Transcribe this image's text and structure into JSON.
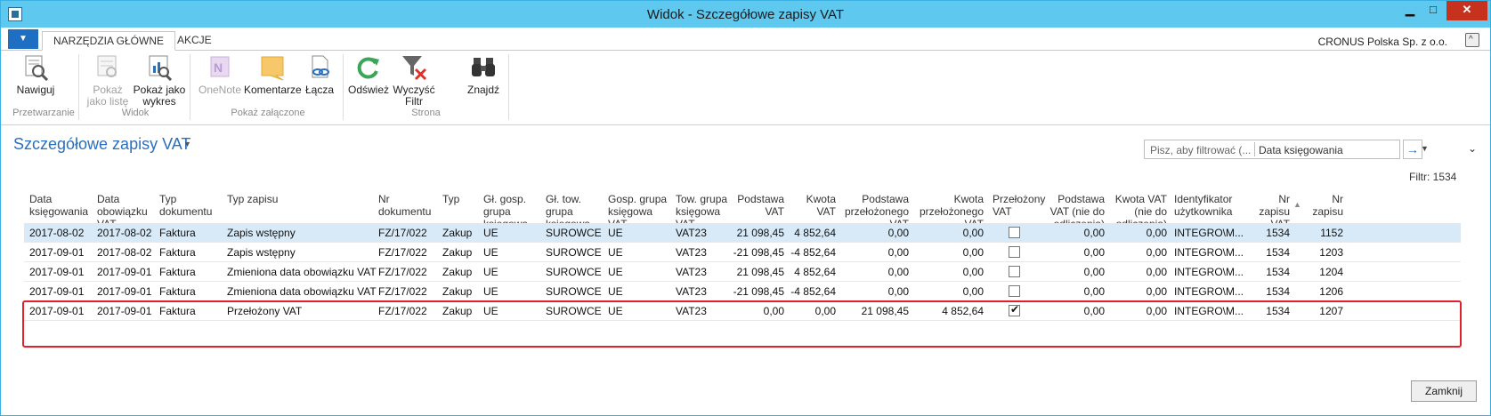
{
  "window": {
    "title": "Widok - Szczegółowe zapisy VAT"
  },
  "ribbon": {
    "tabs": [
      "NARZĘDZIA GŁÓWNE",
      "AKCJE"
    ],
    "company": "CRONUS Polska Sp. z o.o.",
    "buttons": {
      "nawiguj": "Nawiguj",
      "pokaz_liste_1": "Pokaż",
      "pokaz_liste_2": "jako listę",
      "pokaz_wykres_1": "Pokaż jako",
      "pokaz_wykres_2": "wykres",
      "onenote": "OneNote",
      "komentarze": "Komentarze",
      "lacza": "Łącza",
      "odswiez": "Odśwież",
      "wyczysc_1": "Wyczyść",
      "wyczysc_2": "Filtr",
      "znajdz": "Znajdź"
    },
    "groups": {
      "przetwarzanie": "Przetwarzanie",
      "widok": "Widok",
      "pokaz_zalaczone": "Pokaż załączone",
      "strona": "Strona"
    }
  },
  "page": {
    "title": "Szczegółowe zapisy VAT",
    "filter_placeholder": "Pisz, aby filtrować (...",
    "filter_field": "Data księgowania",
    "filter_count": "Filtr: 1534"
  },
  "table": {
    "headers": [
      [
        "Data",
        "księgowania"
      ],
      [
        "Data",
        "obowiązku",
        "VAT"
      ],
      [
        "Typ",
        "dokumentu"
      ],
      [
        "Typ zapisu"
      ],
      [
        "Nr",
        "dokumentu"
      ],
      [
        "Typ"
      ],
      [
        "Gł. gosp.",
        "grupa",
        "księgowa"
      ],
      [
        "Gł. tow.",
        "grupa",
        "księgowa"
      ],
      [
        "Gosp. grupa",
        "księgowa",
        "VAT"
      ],
      [
        "Tow. grupa",
        "księgowa",
        "VAT"
      ],
      [
        "Podstawa",
        "VAT"
      ],
      [
        "Kwota",
        "VAT"
      ],
      [
        "Podstawa",
        "przełożonego",
        "VAT"
      ],
      [
        "Kwota",
        "przełożonego",
        "VAT"
      ],
      [
        "Przełożony",
        "VAT"
      ],
      [
        "Podstawa",
        "VAT (nie do",
        "odliczenia)"
      ],
      [
        "Kwota VAT",
        "(nie do",
        "odliczenia)"
      ],
      [
        "Identyfikator",
        "użytkownika"
      ],
      [
        "Nr",
        "zapisu",
        "VAT"
      ],
      [
        "Nr",
        "zapisu"
      ]
    ],
    "rows": [
      [
        "2017-08-02",
        "2017-08-02",
        "Faktura",
        "Zapis wstępny",
        "FZ/17/022",
        "Zakup",
        "UE",
        "SUROWCE",
        "UE",
        "VAT23",
        "21 098,45",
        "4 852,64",
        "0,00",
        "0,00",
        false,
        "0,00",
        "0,00",
        "INTEGRO\\M...",
        "1534",
        "1152"
      ],
      [
        "2017-09-01",
        "2017-08-02",
        "Faktura",
        "Zapis wstępny",
        "FZ/17/022",
        "Zakup",
        "UE",
        "SUROWCE",
        "UE",
        "VAT23",
        "-21 098,45",
        "-4 852,64",
        "0,00",
        "0,00",
        false,
        "0,00",
        "0,00",
        "INTEGRO\\M...",
        "1534",
        "1203"
      ],
      [
        "2017-09-01",
        "2017-09-01",
        "Faktura",
        "Zmieniona data obowiązku VAT",
        "FZ/17/022",
        "Zakup",
        "UE",
        "SUROWCE",
        "UE",
        "VAT23",
        "21 098,45",
        "4 852,64",
        "0,00",
        "0,00",
        false,
        "0,00",
        "0,00",
        "INTEGRO\\M...",
        "1534",
        "1204"
      ],
      [
        "2017-09-01",
        "2017-09-01",
        "Faktura",
        "Zmieniona data obowiązku VAT",
        "FZ/17/022",
        "Zakup",
        "UE",
        "SUROWCE",
        "UE",
        "VAT23",
        "-21 098,45",
        "-4 852,64",
        "0,00",
        "0,00",
        false,
        "0,00",
        "0,00",
        "INTEGRO\\M...",
        "1534",
        "1206"
      ],
      [
        "2017-09-01",
        "2017-09-01",
        "Faktura",
        "Przełożony VAT",
        "FZ/17/022",
        "Zakup",
        "UE",
        "SUROWCE",
        "UE",
        "VAT23",
        "0,00",
        "0,00",
        "21 098,45",
        "4 852,64",
        true,
        "0,00",
        "0,00",
        "INTEGRO\\M...",
        "1534",
        "1207"
      ]
    ],
    "selected_row": 0
  },
  "footer": {
    "close_label": "Zamknij"
  },
  "colors": {
    "accent": "#2a6fbf",
    "titlebar": "#5ec8ef",
    "highlight": "#e0202a",
    "selection": "#d8eaf8"
  }
}
